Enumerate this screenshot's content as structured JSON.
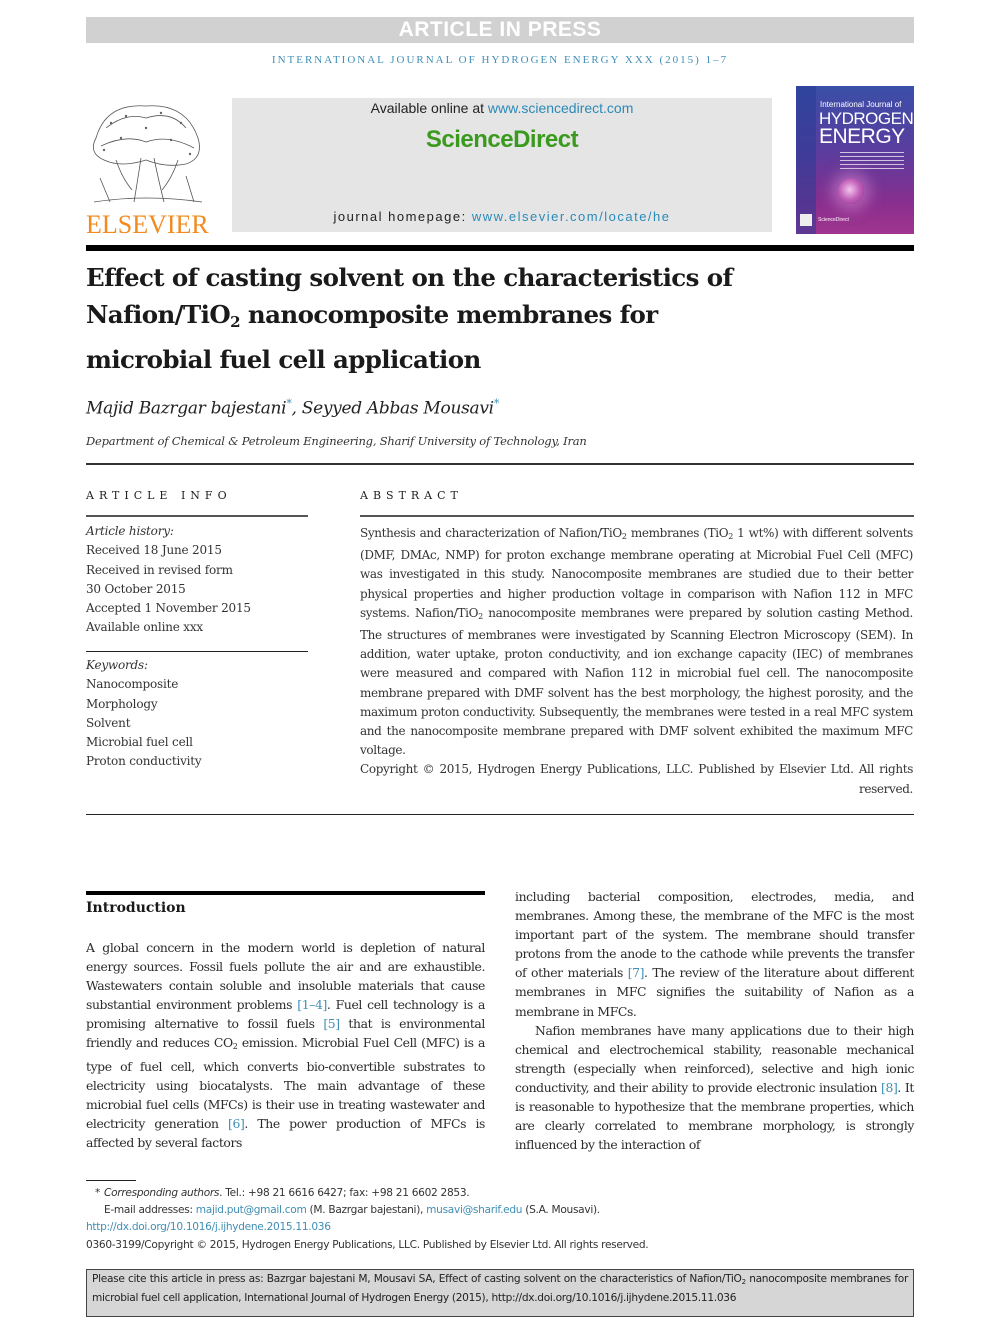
{
  "banner": {
    "article_in_press": "ARTICLE IN PRESS",
    "journal_running_head": "INTERNATIONAL JOURNAL OF HYDROGEN ENERGY XXX (2015) 1–7"
  },
  "header": {
    "publisher_logo_text": "ELSEVIER",
    "available_online_prefix": "Available online at ",
    "available_online_link": "www.sciencedirect.com",
    "platform_brand": "ScienceDirect",
    "homepage_prefix": "journal homepage: ",
    "homepage_link": "www.elsevier.com/locate/he",
    "cover": {
      "line1": "International Journal of",
      "line2": "HYDROGEN",
      "line3": "ENERGY",
      "footer": "ScienceDirect"
    }
  },
  "article": {
    "title_part1": "Effect of casting solvent on the characteristics of",
    "title_part2_pre": "Nafion/TiO",
    "title_part2_sub": "2",
    "title_part2_post": " nanocomposite membranes for",
    "title_part3": "microbial fuel cell application",
    "authors": [
      {
        "name": "Majid Bazrgar bajestani",
        "mark": "*"
      },
      {
        "name": "Seyyed Abbas Mousavi",
        "mark": "*"
      }
    ],
    "author_separator": ", ",
    "affiliation": "Department of Chemical & Petroleum Engineering, Sharif University of Technology, Iran"
  },
  "article_info": {
    "heading": "ARTICLE INFO",
    "history_label": "Article history:",
    "history": [
      "Received 18 June 2015",
      "Received in revised form",
      "30 October 2015",
      "Accepted 1 November 2015",
      "Available online xxx"
    ],
    "keywords_label": "Keywords:",
    "keywords": [
      "Nanocomposite",
      "Morphology",
      "Solvent",
      "Microbial fuel cell",
      "Proton conductivity"
    ]
  },
  "abstract": {
    "heading": "ABSTRACT",
    "s1": "Synthesis and characterization of Nafion/TiO",
    "s1_sub": "2",
    "s2": " membranes (TiO",
    "s2_sub": "2",
    "s3": " 1 wt%) with different solvents (DMF, DMAc, NMP) for proton exchange membrane operating at Microbial Fuel Cell (MFC) was investigated in this study. Nanocomposite membranes are studied due to their better physical properties and higher production voltage in comparison with Nafion 112 in MFC systems. Nafion/TiO",
    "s3_sub": "2",
    "s4": " nanocomposite membranes were prepared by solution casting Method. The structures of membranes were investigated by Scanning Electron Microscopy (SEM). In addition, water uptake, proton conductivity, and ion exchange capacity (IEC) of membranes were measured and compared with Nafion 112 in microbial fuel cell. The nanocomposite membrane prepared with DMF solvent has the best morphology, the highest porosity, and the maximum proton conductivity. Subsequently, the membranes were tested in a real MFC system and the nanocomposite membrane prepared with DMF solvent exhibited the maximum MFC voltage.",
    "copyright": "Copyright © 2015, Hydrogen Energy Publications, LLC. Published by Elsevier Ltd. All rights reserved."
  },
  "introduction": {
    "heading": "Introduction",
    "left": {
      "a": "A global concern in the modern world is depletion of natural energy sources. Fossil fuels pollute the air and are exhaustible. Wastewaters contain soluble and insoluble materials that cause substantial environment problems ",
      "ref1": "[1–4]",
      "b": ". Fuel cell technology is a promising alternative to fossil fuels ",
      "ref2": "[5]",
      "c": " that is environmental friendly and reduces CO",
      "c_sub": "2",
      "d": " emission. Microbial Fuel Cell (MFC) is a type of fuel cell, which converts bio-convertible substrates to electricity using biocatalysts. The main advantage of these microbial fuel cells (MFCs) is their use in treating wastewater and electricity generation ",
      "ref3": "[6]",
      "e": ". The power production of MFCs is affected by several factors"
    },
    "right_p1": {
      "a": "including bacterial composition, electrodes, media, and membranes. Among these, the membrane of the MFC is the most important part of the system. The membrane should transfer protons from the anode to the cathode while prevents the transfer of other materials ",
      "ref": "[7]",
      "b": ". The review of the literature about different membranes in MFC signifies the suitability of Nafion as a membrane in MFCs."
    },
    "right_p2": {
      "a": "Nafion membranes have many applications due to their high chemical and electrochemical stability, reasonable mechanical strength (especially when reinforced), selective and high ionic conductivity, and their ability to provide electronic insulation ",
      "ref": "[8]",
      "b": ". It is reasonable to hypothesize that the membrane properties, which are clearly correlated to membrane morphology, is strongly influenced by the interaction of"
    }
  },
  "footnotes": {
    "star": "*",
    "corresponding_label": "Corresponding authors",
    "contact": ". Tel.: +98 21 6616 6427; fax: +98 21 6602 2853.",
    "email_label": "E-mail addresses: ",
    "email1": "majid.put@gmail.com",
    "email1_owner": " (M. Bazrgar bajestani), ",
    "email2": "musavi@sharif.edu",
    "email2_owner": " (S.A. Mousavi).",
    "doi": "http://dx.doi.org/10.1016/j.ijhydene.2015.11.036",
    "issn_copyright": "0360-3199/Copyright © 2015, Hydrogen Energy Publications, LLC. Published by Elsevier Ltd. All rights reserved."
  },
  "citation_box": {
    "pre": "Please cite this article in press as: Bazrgar bajestani M, Mousavi SA, Effect of casting solvent on the characteristics of Nafion/TiO",
    "sub": "2",
    "post": " nanocomposite membranes for microbial fuel cell application, International Journal of Hydrogen Energy (2015), http://dx.doi.org/10.1016/j.ijhydene.2015.11.036"
  },
  "colors": {
    "link": "#3f8fb5",
    "elsevier_orange": "#f28a1e",
    "sciencedirect_green": "#3a9a1e",
    "banner_gray": "#d1d1d1"
  }
}
